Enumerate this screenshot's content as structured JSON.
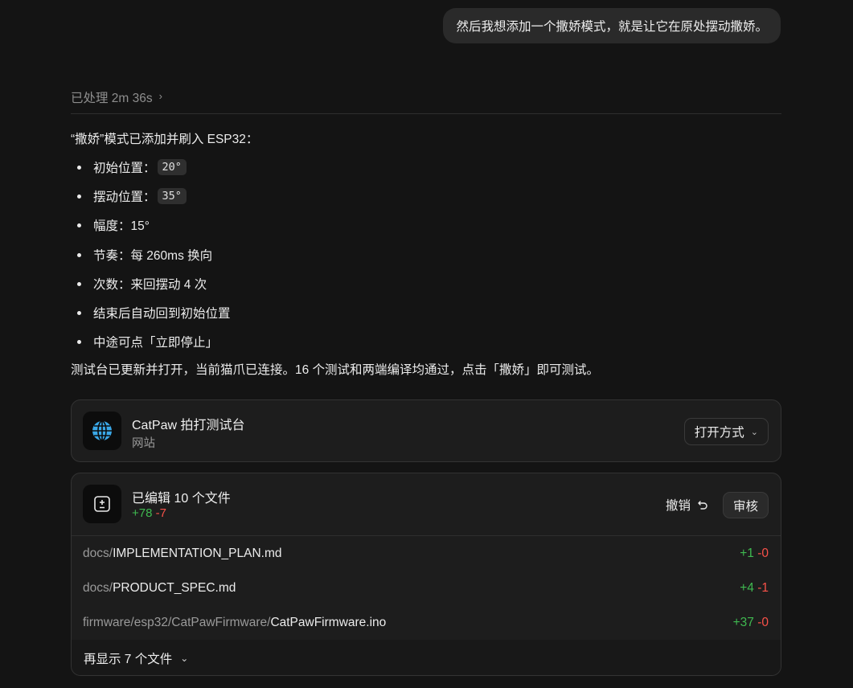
{
  "user_message": "然后我想添加一个撒娇模式，就是让它在原处摆动撒娇。",
  "processed": {
    "label": "已处理 2m 36s",
    "chevron_icon": "chevron-right-icon"
  },
  "answer": {
    "intro": "“撒娇”模式已添加并刷入 ESP32：",
    "bullets": [
      {
        "label": "初始位置：",
        "code": "20°"
      },
      {
        "label": "摆动位置：",
        "code": "35°"
      },
      {
        "label": "幅度：15°"
      },
      {
        "label": "节奏：每 260ms 换向"
      },
      {
        "label": "次数：来回摆动 4 次"
      },
      {
        "label": "结束后自动回到初始位置"
      },
      {
        "label": "中途可点「立即停止」"
      }
    ],
    "summary": "测试台已更新并打开，当前猫爪已连接。16 个测试和两端编译均通过，点击「撒娇」即可测试。"
  },
  "site_card": {
    "title": "CatPaw 拍打测试台",
    "subtitle": "网站",
    "icon": "globe-icon",
    "open_button": "打开方式"
  },
  "edit_card": {
    "title": "已编辑 10 个文件",
    "added": "+78",
    "removed": "-7",
    "icon": "diff-icon",
    "undo_label": "撤销",
    "review_label": "审核",
    "files": [
      {
        "dir": "docs/",
        "name": "IMPLEMENTATION_PLAN.md",
        "added": "+1",
        "removed": "-0"
      },
      {
        "dir": "docs/",
        "name": "PRODUCT_SPEC.md",
        "added": "+4",
        "removed": "-1"
      },
      {
        "dir": "firmware/esp32/CatPawFirmware/",
        "name": "CatPawFirmware.ino",
        "added": "+37",
        "removed": "-0"
      }
    ],
    "show_more": "再显示 7 个文件"
  },
  "colors": {
    "background": "#141414",
    "added": "#3fb950",
    "removed": "#f85149",
    "globe": "#3aa8e8"
  }
}
